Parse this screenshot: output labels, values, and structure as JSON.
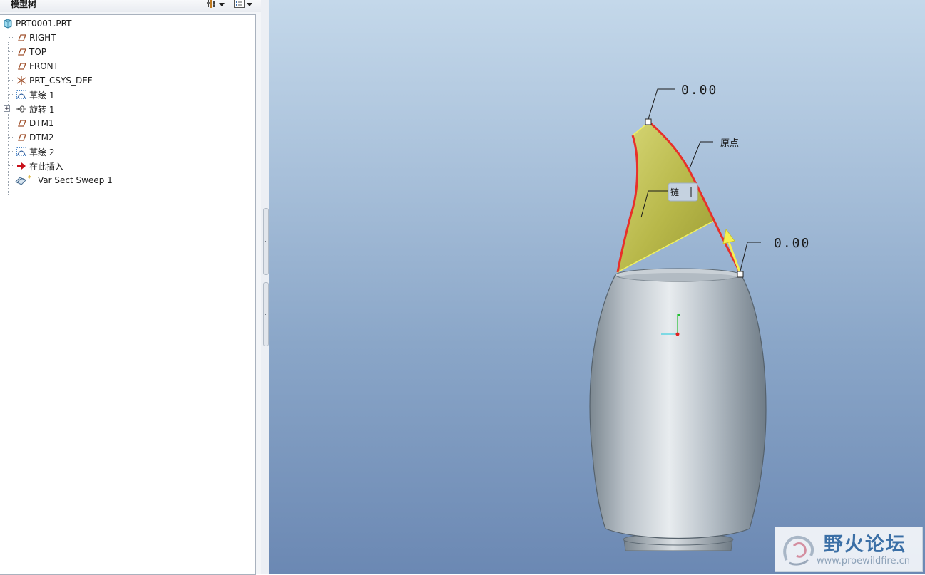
{
  "panel": {
    "title": "模型树",
    "settings_icon": "tree-settings-icon",
    "show_icon": "tree-show-icon"
  },
  "tree": {
    "root": "PRT0001.PRT",
    "items": [
      {
        "label": "RIGHT",
        "icon": "datum-plane-icon"
      },
      {
        "label": "TOP",
        "icon": "datum-plane-icon"
      },
      {
        "label": "FRONT",
        "icon": "datum-plane-icon"
      },
      {
        "label": "PRT_CSYS_DEF",
        "icon": "csys-icon"
      },
      {
        "label": "草绘 1",
        "icon": "sketch-icon"
      },
      {
        "label": "旋转 1",
        "icon": "revolve-icon"
      },
      {
        "label": "DTM1",
        "icon": "datum-plane-icon"
      },
      {
        "label": "DTM2",
        "icon": "datum-plane-icon"
      },
      {
        "label": "草绘 2",
        "icon": "sketch-icon"
      },
      {
        "label": "在此插入",
        "icon": "insert-arrow-icon"
      },
      {
        "label": "Var Sect Sweep 1",
        "icon": "var-sect-sweep-icon"
      }
    ]
  },
  "viewport": {
    "dim_top": "0.00",
    "dim_right": "0.00",
    "origin_label": "原点",
    "link_label": "链"
  },
  "watermark": {
    "title": "野火论坛",
    "url": "www.proewildfire.cn"
  },
  "colors": {
    "background_top": "#c4d8ea",
    "background_bottom": "#6b88b3",
    "surface_preview": "#b8b84a",
    "trajectory": "#e8302a",
    "body": "#aab3bb"
  }
}
